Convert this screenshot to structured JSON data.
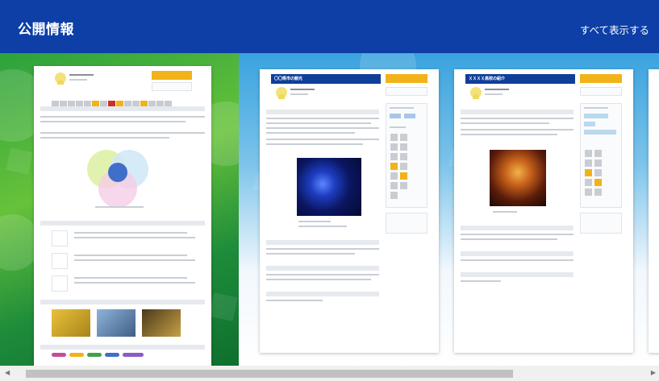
{
  "header": {
    "title": "公開情報",
    "show_all": "すべて表示する",
    "background": "#0d3fa6"
  },
  "gallery": {
    "cards": [
      {
        "theme": "green",
        "accent": "#f2b21a"
      },
      {
        "theme": "blue",
        "doc_title": "〇〇県市の観光",
        "accent": "#f2b21a"
      },
      {
        "theme": "blue",
        "doc_title": "ＸＸＸＸ高校の紹介",
        "accent": "#f2b21a"
      }
    ]
  },
  "scrollbar": {
    "left_arrow": "◀",
    "right_arrow": "▶"
  }
}
